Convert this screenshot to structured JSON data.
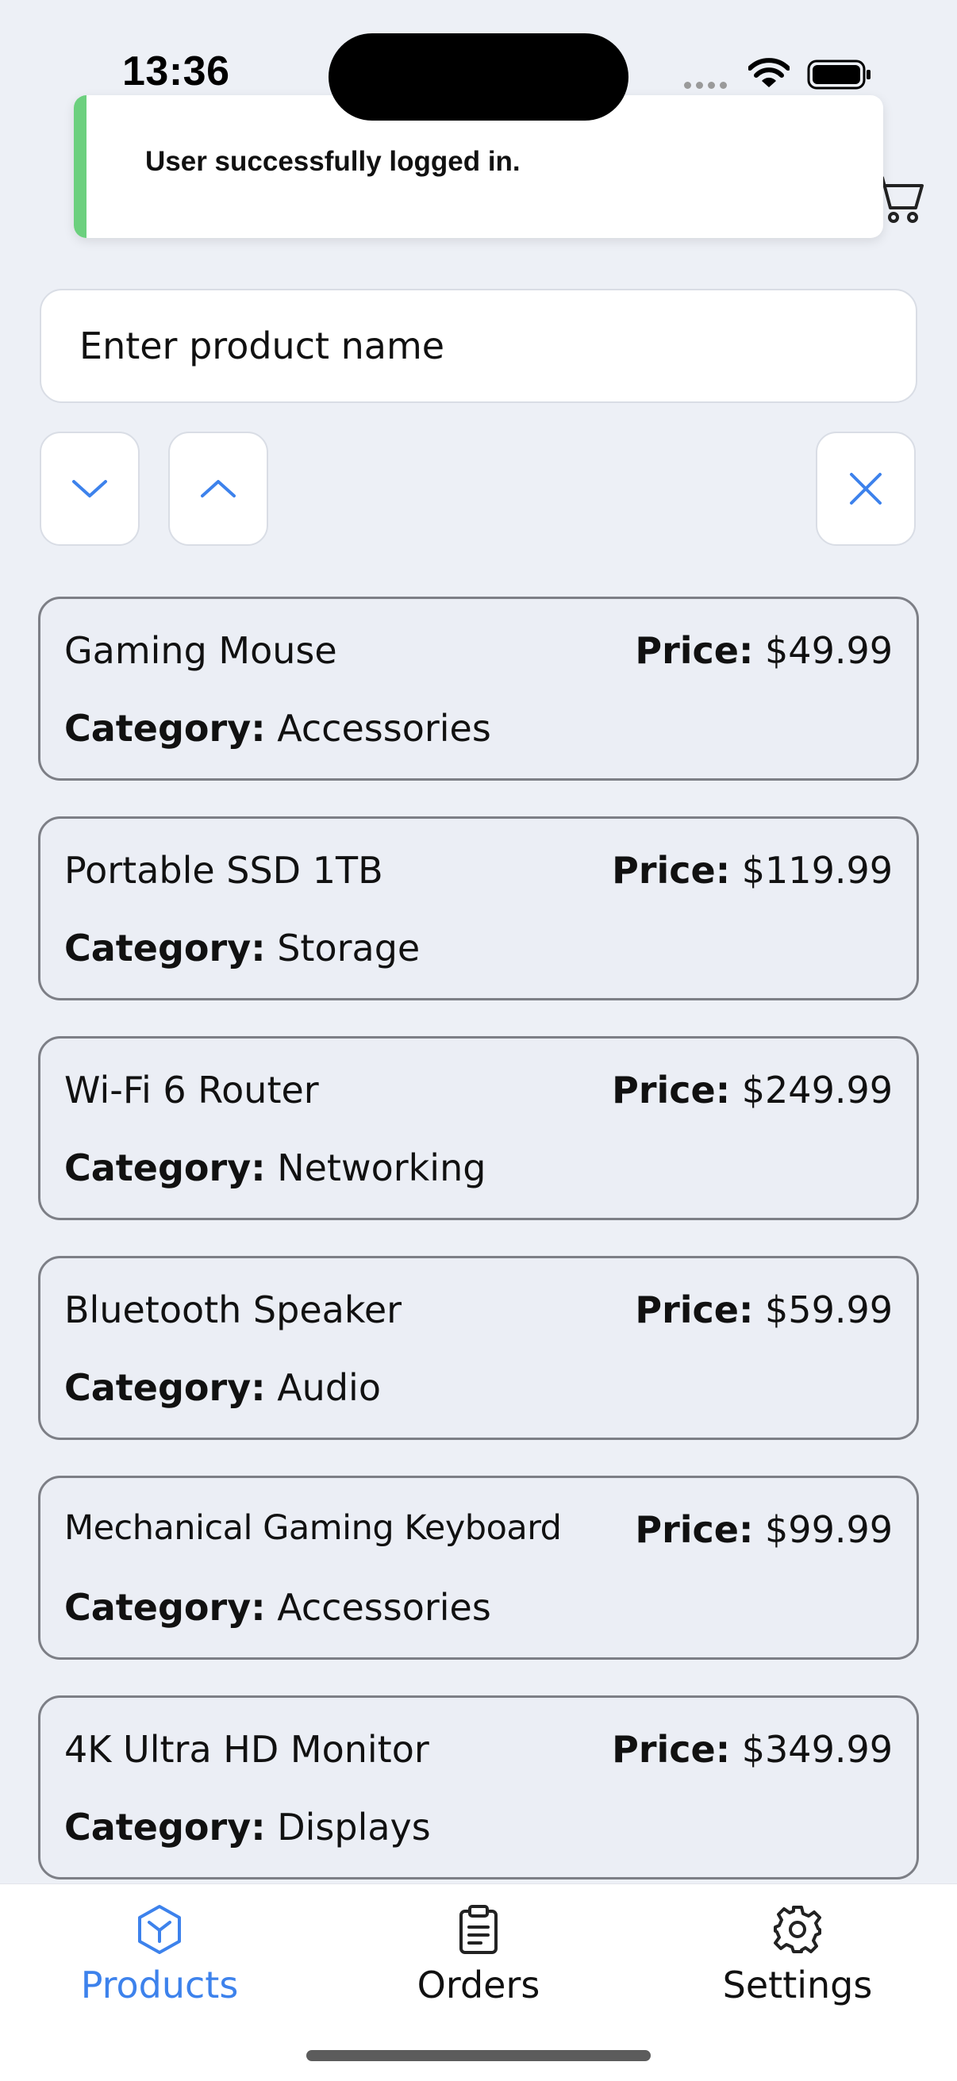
{
  "status_bar": {
    "time": "13:36"
  },
  "toast": {
    "message": "User successfully logged in.",
    "accent_color": "#6cd07e"
  },
  "header": {
    "cart_icon": "cart-icon"
  },
  "search": {
    "placeholder": "Enter product name",
    "value": ""
  },
  "controls": {
    "sort_desc_icon": "chevron-down-icon",
    "sort_asc_icon": "chevron-up-icon",
    "clear_icon": "close-icon"
  },
  "products": [
    {
      "name": "Gaming Mouse",
      "price_label": "Price:",
      "price": "$49.99",
      "category_label": "Category:",
      "category": "Accessories"
    },
    {
      "name": "Portable SSD 1TB",
      "price_label": "Price:",
      "price": "$119.99",
      "category_label": "Category:",
      "category": "Storage"
    },
    {
      "name": "Wi-Fi 6 Router",
      "price_label": "Price:",
      "price": "$249.99",
      "category_label": "Category:",
      "category": "Networking"
    },
    {
      "name": "Bluetooth Speaker",
      "price_label": "Price:",
      "price": "$59.99",
      "category_label": "Category:",
      "category": "Audio"
    },
    {
      "name": "Mechanical Gaming Keyboard",
      "price_label": "Price:",
      "price": "$99.99",
      "category_label": "Category:",
      "category": "Accessories"
    },
    {
      "name": "4K Ultra HD Monitor",
      "price_label": "Price:",
      "price": "$349.99",
      "category_label": "Category:",
      "category": "Displays"
    }
  ],
  "tabs": [
    {
      "label": "Products",
      "icon": "cube-icon",
      "active": true
    },
    {
      "label": "Orders",
      "icon": "clipboard-icon",
      "active": false
    },
    {
      "label": "Settings",
      "icon": "gear-icon",
      "active": false
    }
  ],
  "colors": {
    "accent": "#3d82ec",
    "background": "#edf0f6",
    "card_border": "#7d7f86"
  }
}
